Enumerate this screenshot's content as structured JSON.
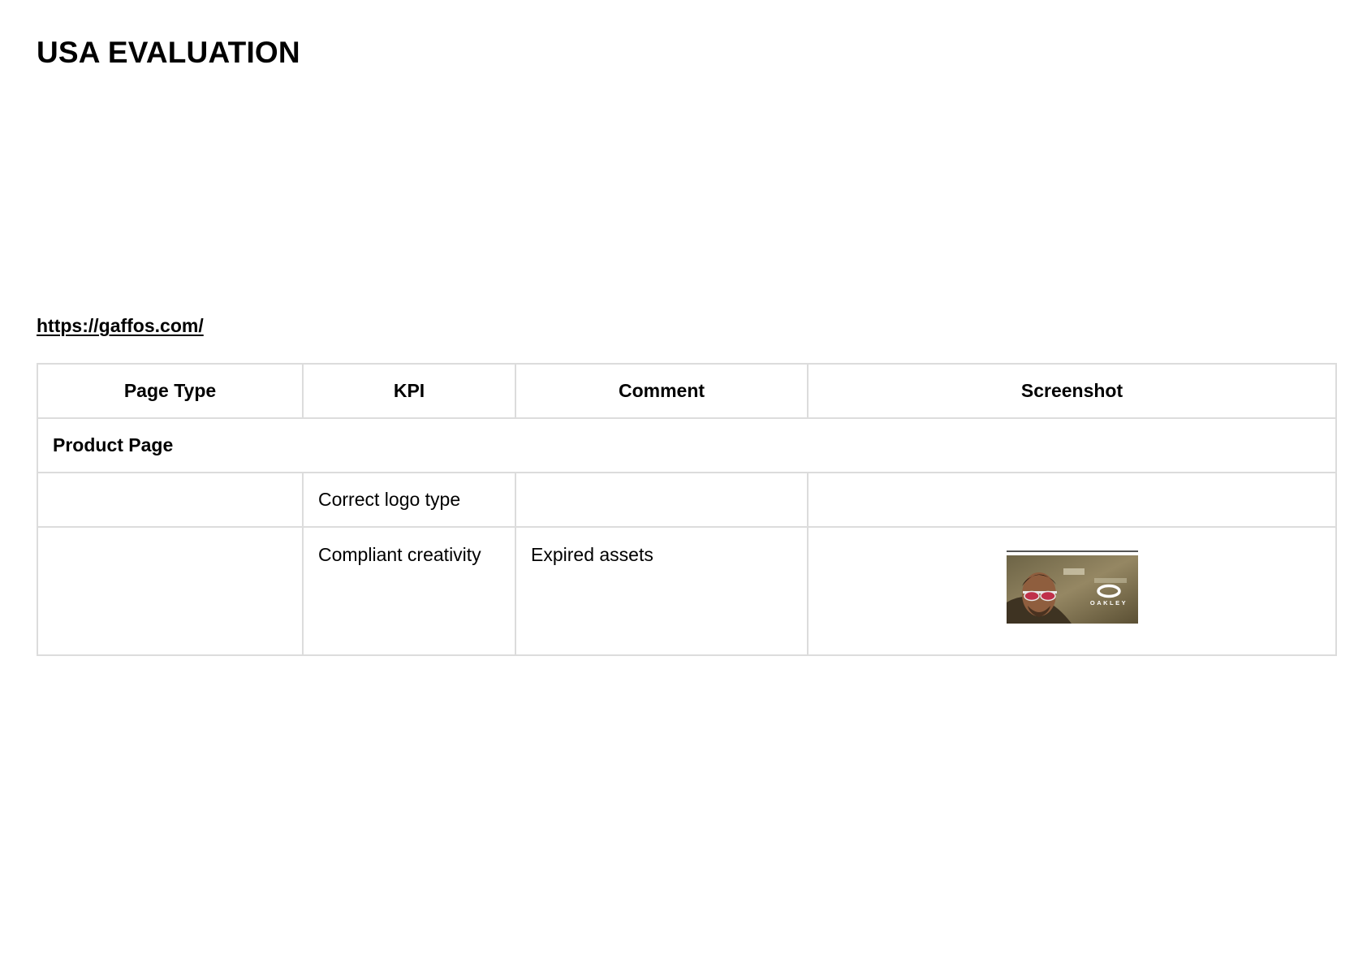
{
  "document": {
    "title": "USA EVALUATION",
    "url": "https://gaffos.com/"
  },
  "table": {
    "headers": [
      "Page Type",
      "KPI",
      "Comment",
      "Screenshot"
    ],
    "section": "Product Page",
    "rows": [
      {
        "page_type": "",
        "kpi": "Correct logo type",
        "comment": "",
        "screenshot": false
      },
      {
        "page_type": "",
        "kpi": "Compliant creativity",
        "comment": "Expired assets",
        "screenshot": true
      }
    ]
  },
  "thumbnail": {
    "logo_text": "OAKLEY",
    "colors": {
      "background": "#8a7a52",
      "lens": "#c0304a",
      "frame": "#e8e8e8"
    }
  }
}
